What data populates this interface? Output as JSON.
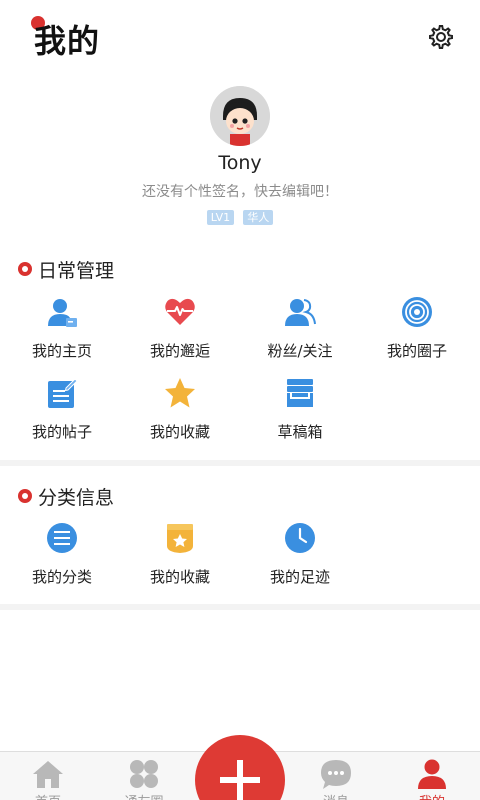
{
  "header": {
    "title": "我的",
    "settings_icon": "gear-icon"
  },
  "profile": {
    "username": "Tony",
    "signature": "还没有个性签名，快去编辑吧！",
    "badges": [
      "LV1",
      "华人"
    ]
  },
  "sections": [
    {
      "title": "日常管理",
      "items": [
        {
          "label": "我的主页",
          "icon": "user-card-icon"
        },
        {
          "label": "我的邂逅",
          "icon": "heart-pulse-icon"
        },
        {
          "label": "粉丝/关注",
          "icon": "users-icon"
        },
        {
          "label": "我的圈子",
          "icon": "target-icon"
        },
        {
          "label": "我的帖子",
          "icon": "edit-document-icon"
        },
        {
          "label": "我的收藏",
          "icon": "star-icon"
        },
        {
          "label": "草稿箱",
          "icon": "inbox-tray-icon"
        }
      ]
    },
    {
      "title": "分类信息",
      "items": [
        {
          "label": "我的分类",
          "icon": "list-circle-icon"
        },
        {
          "label": "我的收藏",
          "icon": "star-box-icon"
        },
        {
          "label": "我的足迹",
          "icon": "clock-icon"
        }
      ]
    }
  ],
  "tabbar": {
    "items": [
      {
        "label": "首页",
        "icon": "home-icon"
      },
      {
        "label": "通友圈",
        "icon": "grid-circles-icon"
      },
      {
        "label": "",
        "icon": "plus-icon"
      },
      {
        "label": "消息",
        "icon": "chat-bubble-icon"
      },
      {
        "label": "我的",
        "icon": "person-icon"
      }
    ]
  },
  "colors": {
    "accent": "#d9322f",
    "icon_blue": "#3a8fe0",
    "icon_red": "#e84a4f",
    "icon_yellow": "#f3b33a",
    "badge": "#b9d6f1"
  }
}
